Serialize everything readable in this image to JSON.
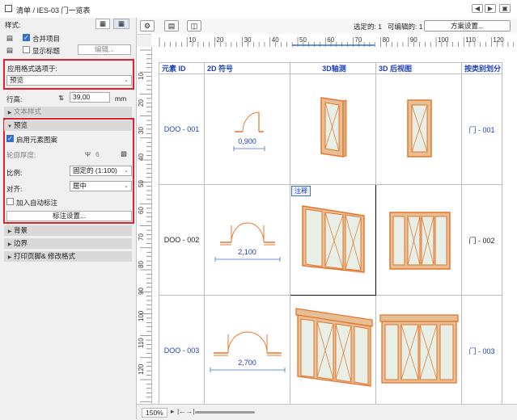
{
  "window": {
    "title": "清单 / IES-03 门一览表"
  },
  "left_panel": {
    "style_label": "样式:",
    "merge_items": "合并项目",
    "show_headers": "显示标题",
    "edit_button": "编辑...",
    "apply_format_label": "应用格式选项于:",
    "apply_format_value": "预览",
    "row_height_label": "行高:",
    "row_height_value": "39,00",
    "row_height_unit": "mm",
    "text_style_section": "文本样式",
    "preview_section": "预览",
    "enable_element_preview": "启用元素图案",
    "outline_thickness_label": "轮廓厚度:",
    "outline_thickness_value": "6",
    "scale_label": "比例:",
    "scale_value": "固定的 (1:100)",
    "align_label": "对齐:",
    "align_value": "居中",
    "auto_dim_label": "加入自动标注",
    "dim_settings_button": "标注设置...",
    "background_section": "背景",
    "border_section": "边界",
    "print_section": "打印页脚& 修改格式"
  },
  "toolbar": {
    "selected_label": "选定的: 1",
    "editable_label": "可编辑的: 1",
    "settings_button": "方案设置..."
  },
  "hruler_ticks": [
    "10",
    "20",
    "30",
    "40",
    "50",
    "60",
    "70",
    "80",
    "90",
    "100",
    "110",
    "120"
  ],
  "vruler_ticks": [
    "10",
    "20",
    "30",
    "40",
    "50",
    "60",
    "70",
    "80",
    "90",
    "100",
    "110",
    "120"
  ],
  "schedule": {
    "headers": [
      "元素 ID",
      "2D 符号",
      "3D轴测",
      "3D 后视图",
      "按类别划分"
    ],
    "rows": [
      {
        "id": "DOO - 001",
        "dim": "0,900",
        "category": "门 - 001"
      },
      {
        "id": "DOO - 002",
        "dim": "2,100",
        "category": "门 - 002"
      },
      {
        "id": "DOO - 003",
        "dim": "2,700",
        "category": "门 - 003"
      }
    ],
    "annotation_tag": "注释"
  },
  "status": {
    "zoom": "150%"
  },
  "colors": {
    "accent": "#1e3fb8",
    "highlight": "#e0202c",
    "door_frame": "#e8742a",
    "door_glass": "#e7efe6",
    "door_wood": "#e5bf96",
    "dim_blue": "#3b6fd6"
  }
}
